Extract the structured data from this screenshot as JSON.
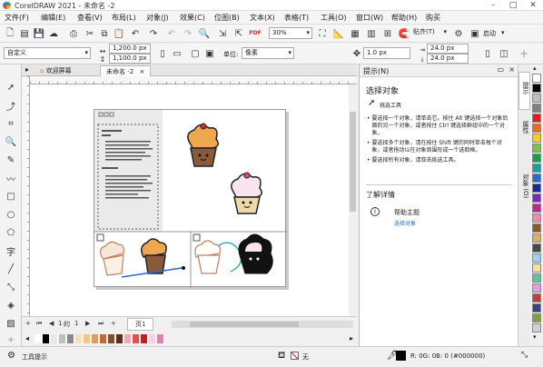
{
  "app": {
    "title": "CorelDRAW 2021 - 未命名 -2"
  },
  "menu": [
    "文件(F)",
    "编辑(E)",
    "查看(V)",
    "布局(L)",
    "对象(J)",
    "效果(C)",
    "位图(B)",
    "文本(X)",
    "表格(T)",
    "工具(O)",
    "窗口(W)",
    "帮助(H)",
    "购买"
  ],
  "toolbar": {
    "zoom": "30%",
    "snap_label": "贴齐(T)",
    "launch_label": "启动",
    "pdf_label": "PDF"
  },
  "propbar": {
    "page_size": "自定义",
    "width": "1,200.0 px",
    "height": "1,100.0 px",
    "unit_label": "单位:",
    "unit_value": "像素",
    "nudge": "1.0 px",
    "dup_x": "24.0 px",
    "dup_y": "24.0 px"
  },
  "doc_tabs": [
    "欢迎屏幕",
    "未命名 -2"
  ],
  "pagenav": {
    "current": "1",
    "of_label": "的",
    "total": "1",
    "page_tab": "页1"
  },
  "hints": {
    "panel_title": "提示(N)",
    "heading": "选择对象",
    "tool_name": "挑选工具",
    "bullets": [
      "要选择一个对象，请单击它。按住 Alt 键选择一个对象后面的另一个对象，或者按住 Ctrl 键选择群组中的一个对象。",
      "要选择多个对象，请在按住 Shift 键的同时单击每个对象，或者拖动以在对象周围形成一个选取框。",
      "要选择所有对象，请双击挑选工具。"
    ],
    "learn_more": "了解详情",
    "help_topics": "帮助主题",
    "help_link": "选择对象"
  },
  "dock_tabs": [
    "提示",
    "属性",
    "对象 (O)"
  ],
  "status": {
    "hint_label": "工具提示",
    "fill_none": "无",
    "color_readout": "R: 0G: 0B: 0 (#000000)"
  },
  "colors": {
    "accent": "#e07b1a",
    "selected_tab": "#ffffff",
    "link": "#1a6fc4"
  },
  "palette_h": [
    "#ffffff",
    "#000000",
    "#e8e8e8",
    "#c0c0c0",
    "#8a8a8a",
    "#f6e0b8",
    "#f4c48a",
    "#e89a5a",
    "#c26a3a",
    "#8b4a2a",
    "#5a2e1a",
    "#f0a8a8",
    "#e05050",
    "#c02020",
    "#f8d0e0",
    "#e080b0"
  ],
  "palette_v": [
    "#ffffff",
    "#000000",
    "#bdbdbd",
    "#808080",
    "#e11d1d",
    "#f06a1a",
    "#f5d01a",
    "#79c24a",
    "#1aa04a",
    "#19a0a0",
    "#2a6ad0",
    "#1a2a9a",
    "#7a2ac0",
    "#c02a8a",
    "#f08ab0",
    "#8a5a2a",
    "#d4b06a",
    "#4a4a4a",
    "#a0d0f0",
    "#f0e0a0",
    "#60c0a0",
    "#e0a0e0",
    "#c04040",
    "#404080",
    "#80a040",
    "#d0d0d0"
  ]
}
